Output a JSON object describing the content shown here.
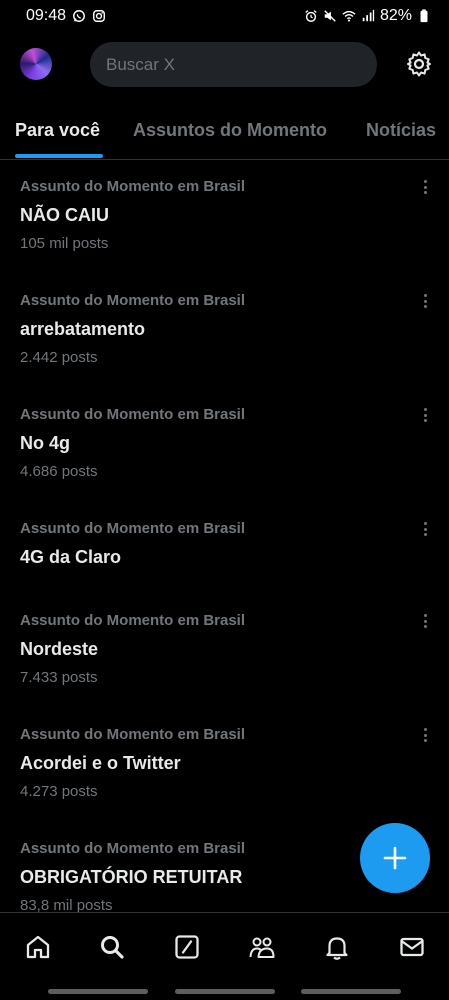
{
  "status_bar": {
    "time": "09:48",
    "battery": "82%"
  },
  "search": {
    "placeholder": "Buscar X"
  },
  "tabs": [
    {
      "label": "Para você",
      "active": true
    },
    {
      "label": "Assuntos do Momento",
      "active": false
    },
    {
      "label": "Notícias",
      "active": false
    }
  ],
  "trends": [
    {
      "context": "Assunto do Momento em Brasil",
      "title": "NÃO CAIU",
      "count": "105 mil posts"
    },
    {
      "context": "Assunto do Momento em Brasil",
      "title": "arrebatamento",
      "count": "2.442 posts"
    },
    {
      "context": "Assunto do Momento em Brasil",
      "title": "No 4g",
      "count": "4.686 posts"
    },
    {
      "context": "Assunto do Momento em Brasil",
      "title": "4G da Claro",
      "count": ""
    },
    {
      "context": "Assunto do Momento em Brasil",
      "title": "Nordeste",
      "count": "7.433 posts"
    },
    {
      "context": "Assunto do Momento em Brasil",
      "title": "Acordei e o Twitter",
      "count": "4.273 posts"
    },
    {
      "context": "Assunto do Momento em Brasil",
      "title": "OBRIGATÓRIO RETUITAR",
      "count": "83,8 mil posts"
    }
  ],
  "bottom_nav": [
    {
      "icon": "home-icon"
    },
    {
      "icon": "search-icon"
    },
    {
      "icon": "grok-icon"
    },
    {
      "icon": "communities-icon"
    },
    {
      "icon": "notifications-icon"
    },
    {
      "icon": "messages-icon"
    }
  ],
  "colors": {
    "background": "#000000",
    "accent": "#1d9bf0",
    "text_primary": "#e7e9ea",
    "text_secondary": "#71767b",
    "divider": "#2f3336"
  }
}
